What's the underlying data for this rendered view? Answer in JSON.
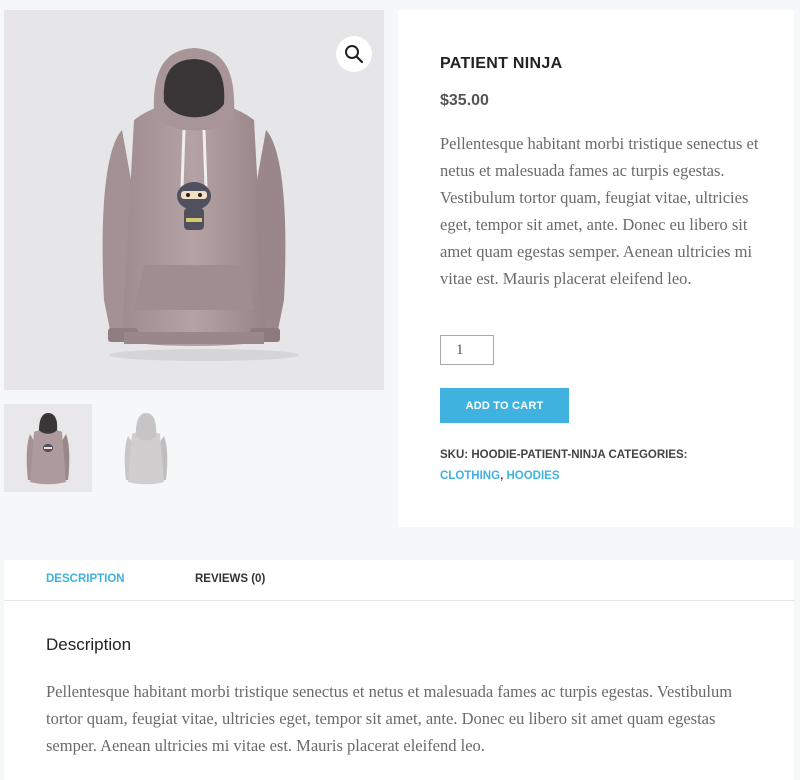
{
  "gallery": {
    "main_image_alt": "Patient Ninja hoodie front",
    "zoom_icon": "magnifier-icon",
    "thumbnails": [
      {
        "alt": "Hoodie front thumbnail"
      },
      {
        "alt": "Hoodie back thumbnail"
      }
    ]
  },
  "product": {
    "title": "PATIENT NINJA",
    "price": "$35.00",
    "short_description": "Pellentesque habitant morbi tristique senectus et netus et malesuada fames ac turpis egestas. Vestibulum tortor quam, feugiat vitae, ultricies eget, tempor sit amet, ante. Donec eu libero sit amet quam egestas semper. Aenean ultricies mi vitae est. Mauris placerat eleifend leo.",
    "quantity": "1",
    "add_to_cart_label": "ADD TO CART",
    "meta": {
      "sku_label": "SKU:",
      "sku": "HOODIE-PATIENT-NINJA",
      "categories_label": "CATEGORIES:",
      "category_1": "CLOTHING",
      "separator": ", ",
      "category_2": "HOODIES"
    }
  },
  "tabs": {
    "items": [
      {
        "label": "DESCRIPTION"
      },
      {
        "label": "REVIEWS (0)"
      }
    ],
    "panel_heading": "Description",
    "panel_text": "Pellentesque habitant morbi tristique senectus et netus et malesuada fames ac turpis egestas. Vestibulum tortor quam, feugiat vitae, ultricies eget, tempor sit amet, ante. Donec eu libero sit amet quam egestas semper. Aenean ultricies mi vitae est. Mauris placerat eleifend leo."
  },
  "colors": {
    "accent": "#3fb2df",
    "page_background": "#f4f8f9",
    "hoodie": "#ad9a9c"
  }
}
